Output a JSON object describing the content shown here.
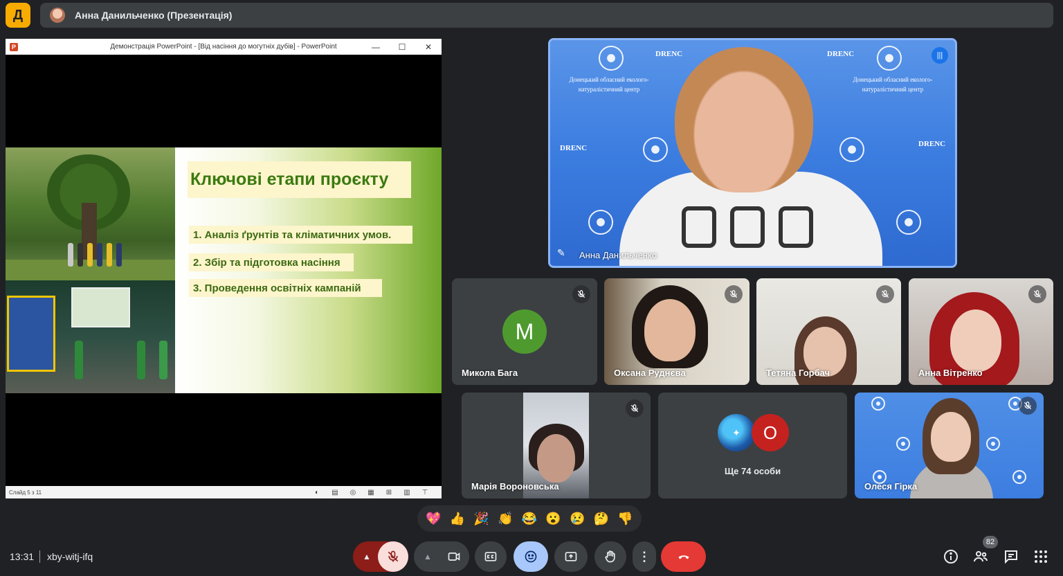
{
  "app_badge": "Д",
  "top_bar": {
    "title": "Анна Данильченко (Презентація)"
  },
  "presentation": {
    "window_title": "Демонстрація PowerPoint - [Від насіння до могутніх дубів] - PowerPoint",
    "window_controls": [
      "—",
      "☐",
      "✕"
    ],
    "slide": {
      "title": "Ключові етапи проєкту",
      "items": [
        "1. Аналіз ґрунтів та кліматичних умов.",
        "2. Збір та підготовка насіння",
        "3. Проведення освітніх кампаній"
      ]
    },
    "status": {
      "slide_counter": "Слайд 5 з 11"
    }
  },
  "main_speaker": {
    "name": "Анна Данильченко",
    "bg_label": "DRENC",
    "bg_caption": "Донецький обласний еколого-натуралістичний центр"
  },
  "participants": [
    {
      "name": "Микола Бага",
      "avatar_letter": "M",
      "avatar_color": "#4f9a2f"
    },
    {
      "name": "Оксана Руднєва"
    },
    {
      "name": "Тетяна Горбач"
    },
    {
      "name": "Анна Вітренко"
    },
    {
      "name": "Марія Вороновська"
    },
    {
      "more_label": "Ще 74 особи",
      "avatar_letter": "O",
      "avatar_color": "#c5221f"
    },
    {
      "name": "Олеся Гірка"
    }
  ],
  "reactions": [
    "💖",
    "👍",
    "🎉",
    "👏",
    "😂",
    "😮",
    "😢",
    "🤔",
    "👎"
  ],
  "bottom": {
    "time": "13:31",
    "meeting_code": "xby-witj-ifq",
    "people_count": "82"
  },
  "colors": {
    "end_call": "#e53935",
    "mic_muted": "#f9dedc",
    "mic_group": "#8c1d18",
    "emoji_button": "#a8c7fa",
    "accent": "#8ab4f8"
  }
}
